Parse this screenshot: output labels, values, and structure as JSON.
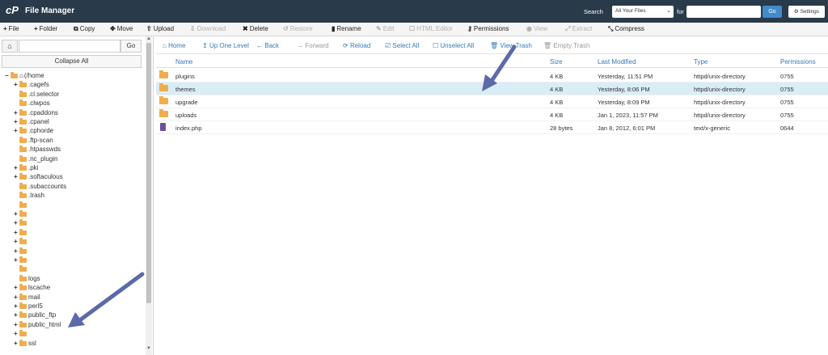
{
  "app": {
    "logo": "cP",
    "title": "File Manager"
  },
  "search": {
    "label": "Search",
    "scope": "All Your Files",
    "for_label": "for",
    "go": "Go",
    "settings": "Settings"
  },
  "toolbar": {
    "file": "File",
    "folder": "Folder",
    "copy": "Copy",
    "move": "Move",
    "upload": "Upload",
    "download": "Download",
    "delete": "Delete",
    "restore": "Restore",
    "rename": "Rename",
    "edit": "Edit",
    "html_editor": "HTML Editor",
    "permissions": "Permissions",
    "view": "View",
    "extract": "Extract",
    "compress": "Compress"
  },
  "left": {
    "go": "Go",
    "collapse_all": "Collapse All"
  },
  "tree": [
    {
      "label": "(/home",
      "expander": "−",
      "level": 0
    },
    {
      "label": ".cagefs",
      "expander": "+",
      "level": 1
    },
    {
      "label": ".cl.selector",
      "expander": "",
      "level": 1
    },
    {
      "label": ".clwpos",
      "expander": "",
      "level": 1
    },
    {
      "label": ".cpaddons",
      "expander": "+",
      "level": 1
    },
    {
      "label": ".cpanel",
      "expander": "+",
      "level": 1
    },
    {
      "label": ".cphorde",
      "expander": "+",
      "level": 1
    },
    {
      "label": ".ftp-scan",
      "expander": "",
      "level": 1
    },
    {
      "label": ".htpasswds",
      "expander": "",
      "level": 1
    },
    {
      "label": ".nc_plugin",
      "expander": "",
      "level": 1
    },
    {
      "label": ".pki",
      "expander": "+",
      "level": 1
    },
    {
      "label": ".softaculous",
      "expander": "+",
      "level": 1
    },
    {
      "label": ".subaccounts",
      "expander": "",
      "level": 1
    },
    {
      "label": ".trash",
      "expander": "",
      "level": 1
    },
    {
      "label": "",
      "expander": "",
      "level": 1
    },
    {
      "label": "",
      "expander": "+",
      "level": 1
    },
    {
      "label": "",
      "expander": "+",
      "level": 1
    },
    {
      "label": "",
      "expander": "+",
      "level": 1
    },
    {
      "label": "",
      "expander": "+",
      "level": 1
    },
    {
      "label": "",
      "expander": "+",
      "level": 1
    },
    {
      "label": "",
      "expander": "+",
      "level": 1
    },
    {
      "label": "",
      "expander": "",
      "level": 1
    },
    {
      "label": "logs",
      "expander": "",
      "level": 1
    },
    {
      "label": "lscache",
      "expander": "+",
      "level": 1
    },
    {
      "label": "mail",
      "expander": "+",
      "level": 1
    },
    {
      "label": "perl5",
      "expander": "+",
      "level": 1
    },
    {
      "label": "public_ftp",
      "expander": "+",
      "level": 1
    },
    {
      "label": "public_html",
      "expander": "+",
      "level": 1
    },
    {
      "label": "",
      "expander": "+",
      "level": 1
    },
    {
      "label": "ssl",
      "expander": "+",
      "level": 1
    }
  ],
  "nav": {
    "home": "Home",
    "up": "Up One Level",
    "back": "Back",
    "forward": "Forward",
    "reload": "Reload",
    "select_all": "Select All",
    "unselect_all": "Unselect All",
    "view_trash": "View Trash",
    "empty_trash": "Empty Trash"
  },
  "columns": {
    "name": "Name",
    "size": "Size",
    "modified": "Last Modified",
    "type": "Type",
    "perms": "Permissions"
  },
  "files": [
    {
      "name": "plugins",
      "size": "4 KB",
      "modified": "Yesterday, 11:51 PM",
      "type": "httpd/unix-directory",
      "perms": "0755",
      "kind": "folder"
    },
    {
      "name": "themes",
      "size": "4 KB",
      "modified": "Yesterday, 8:06 PM",
      "type": "httpd/unix-directory",
      "perms": "0755",
      "kind": "folder",
      "selected": true
    },
    {
      "name": "upgrade",
      "size": "4 KB",
      "modified": "Yesterday, 8:09 PM",
      "type": "httpd/unix-directory",
      "perms": "0755",
      "kind": "folder"
    },
    {
      "name": "uploads",
      "size": "4 KB",
      "modified": "Jan 1, 2023, 11:57 PM",
      "type": "httpd/unix-directory",
      "perms": "0755",
      "kind": "folder"
    },
    {
      "name": "index.php",
      "size": "28 bytes",
      "modified": "Jan 8, 2012, 6:01 PM",
      "type": "text/x-generic",
      "perms": "0644",
      "kind": "file"
    }
  ],
  "colors": {
    "topbar": "#293a4a",
    "accent": "#337ab7",
    "arrow": "#5b6aa8",
    "folder": "#f0ad4e",
    "selected": "#d9edf7"
  }
}
